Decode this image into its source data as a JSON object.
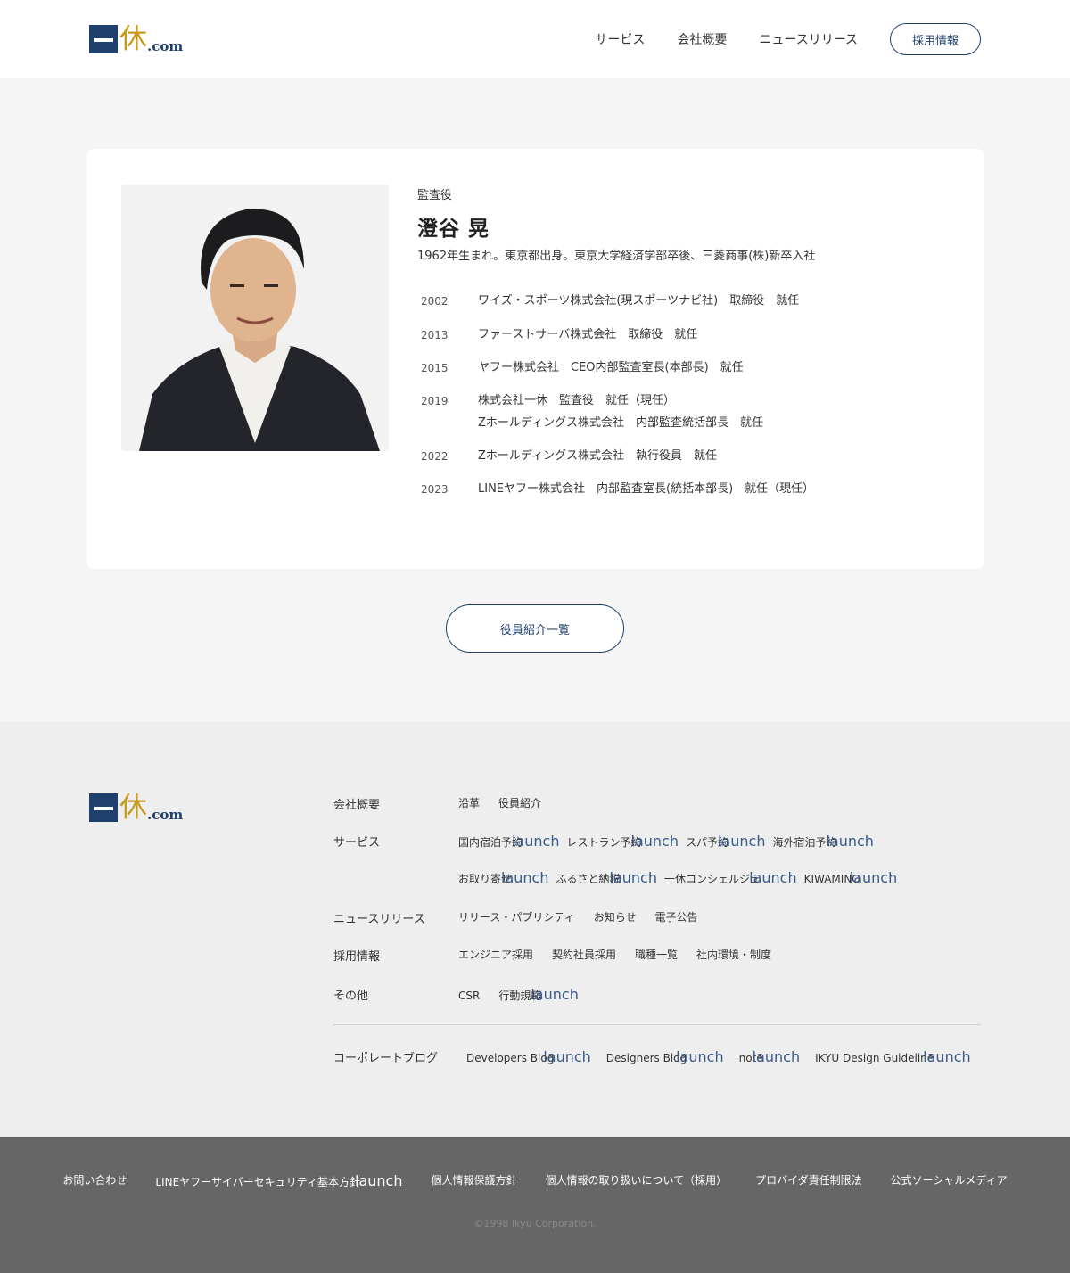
{
  "header": {
    "logo": {
      "mark": "一",
      "kanji": "休",
      "suffix": ".com"
    },
    "nav": [
      "サービス",
      "会社概要",
      "ニュースリリース"
    ],
    "recruit_button": "採用情報"
  },
  "profile": {
    "role": "監査役",
    "name": "澄谷 晃",
    "bio": "1962年生まれ。東京都出身。東京大学経済学部卒後、三菱商事(株)新卒入社",
    "photo_icon": "portrait-photo",
    "history": [
      {
        "year": "2002",
        "lines": [
          "ワイズ・スポーツ株式会社(現スポーツナビ社)　取締役　就任"
        ]
      },
      {
        "year": "2013",
        "lines": [
          "ファーストサーバ株式会社　取締役　就任"
        ]
      },
      {
        "year": "2015",
        "lines": [
          "ヤフー株式会社　CEO内部監査室長(本部長)　就任"
        ]
      },
      {
        "year": "2019",
        "lines": [
          "株式会社一休　監査役　就任（現任）",
          "Zホールディングス株式会社　内部監査統括部長　就任"
        ]
      },
      {
        "year": "2022",
        "lines": [
          "Zホールディングス株式会社　執行役員　就任"
        ]
      },
      {
        "year": "2023",
        "lines": [
          "LINEヤフー株式会社　内部監査室長(統括本部長)　就任（現任）"
        ]
      }
    ]
  },
  "list_button": "役員紹介一覧",
  "footer": {
    "ext_icon_text": "launch",
    "sections": [
      {
        "head": "会社概要",
        "links": [
          {
            "label": "沿革"
          },
          {
            "label": "役員紹介"
          }
        ]
      },
      {
        "head": "サービス",
        "links": [
          {
            "label": "国内宿泊予約",
            "ext": true
          },
          {
            "label": "レストラン予約",
            "ext": true
          },
          {
            "label": "スパ予約",
            "ext": true
          },
          {
            "label": "海外宿泊予約",
            "ext": true
          }
        ]
      },
      {
        "head": "",
        "links": [
          {
            "label": "お取り寄せ",
            "ext": true
          },
          {
            "label": "ふるさと納税",
            "ext": true
          },
          {
            "label": "一休コンシェルジュ",
            "ext": true
          },
          {
            "label": "KIWAMINO",
            "ext": true
          }
        ]
      },
      {
        "head": "ニュースリリース",
        "links": [
          {
            "label": "リリース・パブリシティ"
          },
          {
            "label": "お知らせ"
          },
          {
            "label": "電子公告"
          }
        ]
      },
      {
        "head": "採用情報",
        "links": [
          {
            "label": "エンジニア採用"
          },
          {
            "label": "契約社員採用"
          },
          {
            "label": "職種一覧"
          },
          {
            "label": "社内環境・制度"
          }
        ]
      },
      {
        "head": "その他",
        "links": [
          {
            "label": "CSR"
          },
          {
            "label": "行動規範",
            "ext": true
          }
        ]
      }
    ],
    "blog": {
      "head": "コーポレートブログ",
      "links": [
        {
          "label": "Developers Blog",
          "ext": true
        },
        {
          "label": "Designers Blog",
          "ext": true
        },
        {
          "label": "note",
          "ext": true
        },
        {
          "label": "IKYU Design Guideline",
          "ext": true
        }
      ]
    }
  },
  "bottom": {
    "links": [
      {
        "label": "お問い合わせ"
      },
      {
        "label": "LINEヤフーサイバーセキュリティ基本方針",
        "ext": true
      },
      {
        "label": "個人情報保護方針"
      },
      {
        "label": "個人情報の取り扱いについて（採用）"
      },
      {
        "label": "プロバイダ責任制限法"
      },
      {
        "label": "公式ソーシャルメディア"
      }
    ],
    "copyright": "©1998 Ikyu Corporation."
  }
}
